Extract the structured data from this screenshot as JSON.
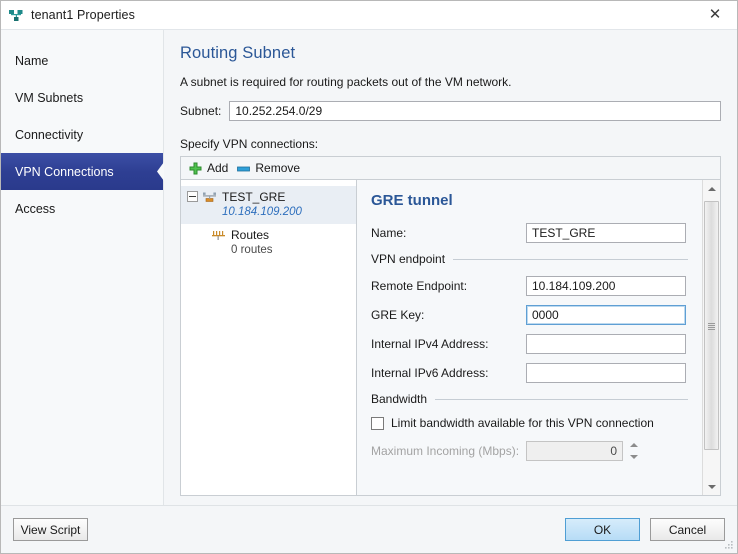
{
  "window": {
    "title": "tenant1 Properties",
    "icon": "network-icon",
    "close_label": "✕"
  },
  "sidebar": {
    "items": [
      {
        "label": "Name",
        "selected": false
      },
      {
        "label": "VM Subnets",
        "selected": false
      },
      {
        "label": "Connectivity",
        "selected": false
      },
      {
        "label": "VPN Connections",
        "selected": true
      },
      {
        "label": "Access",
        "selected": false
      }
    ],
    "selected_color": "#2e3f93"
  },
  "main": {
    "page_title": "Routing Subnet",
    "description": "A subnet is required for routing packets out of the VM network.",
    "subnet_label": "Subnet:",
    "subnet_value": "10.252.254.0/29",
    "subnet_placeholder": "",
    "specify_label": "Specify VPN connections:",
    "toolbar": {
      "add_label": "Add",
      "add_icon": "plus-icon",
      "remove_label": "Remove",
      "remove_icon": "minus-icon"
    },
    "tree": {
      "nodes": [
        {
          "title": "TEST_GRE",
          "subtitle": "10.184.109.200",
          "icon": "vpn-tunnel-icon",
          "expander": "collapse-icon"
        },
        {
          "title": "Routes",
          "subtitle": "0 routes",
          "icon": "routes-icon"
        }
      ]
    },
    "detail": {
      "title": "GRE tunnel",
      "name_label": "Name:",
      "name_value": "TEST_GRE",
      "vpn_endpoint_group": "VPN endpoint",
      "remote_endpoint_label": "Remote Endpoint:",
      "remote_endpoint_value": "10.184.109.200",
      "gre_key_label": "GRE Key:",
      "gre_key_value": "0000",
      "internal_ipv4_label": "Internal IPv4 Address:",
      "internal_ipv4_value": "",
      "internal_ipv6_label": "Internal IPv6 Address:",
      "internal_ipv6_value": "",
      "bandwidth_group": "Bandwidth",
      "limit_checkbox_label": "Limit bandwidth available for this VPN connection",
      "max_incoming_label": "Maximum Incoming (Mbps):",
      "max_incoming_value": "0",
      "accent_color": "#2b5797",
      "focus_color": "#5f9fd4"
    }
  },
  "footer": {
    "view_script_label": "View Script",
    "ok_label": "OK",
    "cancel_label": "Cancel"
  }
}
